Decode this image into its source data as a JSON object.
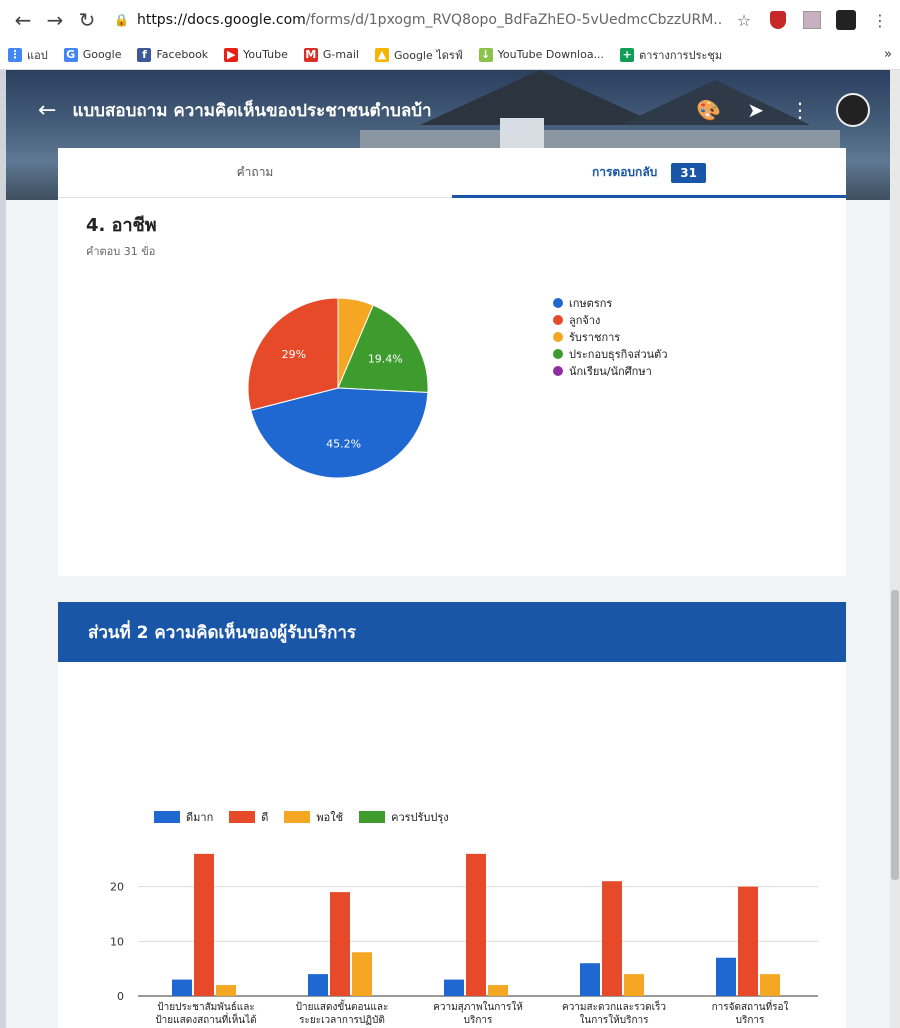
{
  "browser": {
    "url_host": "https://docs.google.com",
    "url_path": "/forms/d/1pxogm_RVQ8opo_BdFaZhEO-5vUedmcCbzzURM...",
    "bookmarks": [
      {
        "label": "แอป",
        "icon": "apps-grid-icon",
        "color": "#4285f4"
      },
      {
        "label": "Google",
        "icon": "google-icon",
        "color": "#4285f4"
      },
      {
        "label": "Facebook",
        "icon": "facebook-icon",
        "color": "#3b5998"
      },
      {
        "label": "YouTube",
        "icon": "youtube-icon",
        "color": "#e62117"
      },
      {
        "label": "G-mail",
        "icon": "gmail-icon",
        "color": "#d93025"
      },
      {
        "label": "Google ไดรฟ์",
        "icon": "drive-icon",
        "color": "#f4b400"
      },
      {
        "label": "YouTube Downloa...",
        "icon": "download-icon",
        "color": "#8bc34a"
      },
      {
        "label": "ตารางการประชุม",
        "icon": "calendar-icon",
        "color": "#0f9d58"
      }
    ],
    "more_label": "»"
  },
  "form": {
    "title": "แบบสอบถาม ความคิดเห็นของประชาชนตำบลบ้า",
    "tabs": [
      {
        "label": "คำถาม"
      },
      {
        "label": "การตอบกลับ",
        "badge": "31"
      }
    ]
  },
  "question": {
    "title": "4. อาชีพ",
    "subtitle": "คำตอบ 31 ข้อ"
  },
  "section": {
    "title": "ส่วนที่ 2 ความคิดเห็นของผู้รับบริการ"
  },
  "chart_data": [
    {
      "type": "pie",
      "legend_position": "right",
      "slices": [
        {
          "label": "เกษตรกร",
          "value": 45.2,
          "color": "#1f67d1",
          "display": "45.2%"
        },
        {
          "label": "ลูกจ้าง",
          "value": 29.0,
          "color": "#e64a28",
          "display": "29%"
        },
        {
          "label": "รับราชการ",
          "value": 6.4,
          "color": "#f5a623",
          "display": ""
        },
        {
          "label": "ประกอบธุรกิจส่วนตัว",
          "value": 19.4,
          "color": "#3e9b2e",
          "display": "19.4%"
        },
        {
          "label": "นักเรียน/นักศึกษา",
          "value": 0,
          "color": "#8e2fa0",
          "display": ""
        }
      ]
    },
    {
      "type": "bar",
      "legend_position": "top",
      "categories": [
        [
          "ป้ายประชาสัมพันธ์และ",
          "ป้ายแสดงสถานที่เห็นได้"
        ],
        [
          "ป้ายแสดงขั้นตอนและ",
          "ระยะเวลาการปฏิบัติ"
        ],
        [
          "ความสุภาพในการให้",
          "บริการ"
        ],
        [
          "ความสะดวกและรวดเร็ว",
          "ในการให้บริการ"
        ],
        [
          "การจัดสถานที่รอใ",
          "บริการ"
        ]
      ],
      "series": [
        {
          "name": "ดีมาก",
          "color": "#1f67d1",
          "values": [
            3,
            4,
            3,
            6,
            7
          ]
        },
        {
          "name": "ดี",
          "color": "#e64a28",
          "values": [
            26,
            19,
            26,
            21,
            20
          ]
        },
        {
          "name": "พอใช้",
          "color": "#f5a623",
          "values": [
            2,
            8,
            2,
            4,
            4
          ]
        },
        {
          "name": "ควรปรับปรุง",
          "color": "#3e9b2e",
          "values": [
            0,
            0,
            0,
            0,
            0
          ]
        }
      ],
      "ylim": [
        0,
        30
      ],
      "yticks": [
        0,
        10,
        20
      ],
      "grid": true
    }
  ]
}
